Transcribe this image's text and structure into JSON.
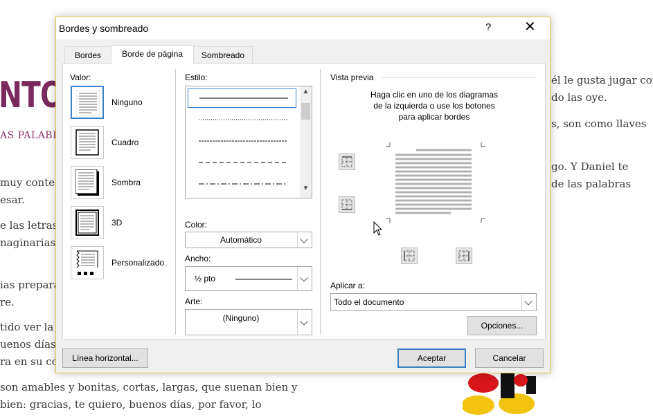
{
  "background_doc": {
    "title": "NTOS",
    "subtitle": "AS PALABRAS",
    "left_lines": [
      "muy conte",
      "esar.",
      "e las letras",
      "naginarias,",
      "ias preparan",
      "re.",
      "tido ver la c",
      "uenos días,",
      "ra en su co"
    ],
    "right_lines": [
      "él le gusta jugar con",
      "do las oye.",
      "s, son como llaves",
      "go. Y Daniel te",
      "de las palabras"
    ],
    "bottom_lines": [
      "son amables y bonitas, cortas, largas, que suenan bien y",
      "bien: gracias, te quiero, buenos días, por favor, lo"
    ]
  },
  "dialog": {
    "title": "Bordes y sombreado",
    "help_glyph": "?",
    "close_glyph": "✕",
    "tabs": [
      {
        "label": "Bordes",
        "active": false
      },
      {
        "label": "Borde de página",
        "active": true
      },
      {
        "label": "Sombreado",
        "active": false
      }
    ],
    "setting": {
      "label": "Valor:",
      "options": [
        {
          "label": "Ninguno",
          "selected": true,
          "icon": "page-none-icon"
        },
        {
          "label": "Cuadro",
          "selected": false,
          "icon": "page-box-icon"
        },
        {
          "label": "Sombra",
          "selected": false,
          "icon": "page-shadow-icon"
        },
        {
          "label": "3D",
          "selected": false,
          "icon": "page-3d-icon"
        },
        {
          "label": "Personalizado",
          "selected": false,
          "icon": "page-custom-icon"
        }
      ]
    },
    "style": {
      "label": "Estilo:",
      "items": [
        "solid",
        "dotted",
        "dashed-fine",
        "dashed",
        "dash-dot"
      ],
      "selected_index": 0
    },
    "color": {
      "label": "Color:",
      "value": "Automático"
    },
    "width": {
      "label": "Ancho:",
      "value": "½ pto"
    },
    "art": {
      "label": "Arte:",
      "value": "(Ninguno)"
    },
    "preview": {
      "label": "Vista previa",
      "instructions": [
        "Haga clic en uno de los diagramas",
        "de la izquierda o use los botones",
        "para aplicar bordes"
      ]
    },
    "apply_to": {
      "label": "Aplicar a:",
      "value": "Todo el documento"
    },
    "options_button": "Opciones...",
    "horizontal_line_button": "Línea horizontal...",
    "ok_button": "Aceptar",
    "cancel_button": "Cancelar"
  },
  "colors": {
    "accent": "#3c7fc6",
    "title_purple": "#7b2a5d",
    "dialog_border": "#e3c44a"
  }
}
